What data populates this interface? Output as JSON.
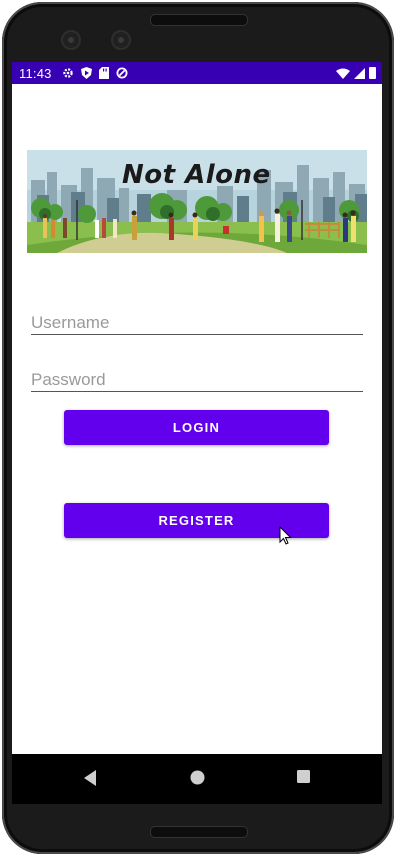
{
  "status_bar": {
    "time": "11:43",
    "icons_left": [
      "gear-icon",
      "shield-play-icon",
      "sd-card-icon",
      "data-saver-icon"
    ],
    "icons_right": [
      "wifi-icon",
      "signal-icon",
      "battery-icon"
    ],
    "background": "#3700b3"
  },
  "banner": {
    "title": "Not Alone"
  },
  "login_form": {
    "username_placeholder": "Username",
    "password_placeholder": "Password",
    "login_label": "LOGIN",
    "register_label": "REGISTER"
  },
  "nav_bar": {
    "buttons": [
      "back-icon",
      "home-icon",
      "recents-icon"
    ]
  },
  "colors": {
    "accent": "#6200ee",
    "status": "#3700b3"
  }
}
